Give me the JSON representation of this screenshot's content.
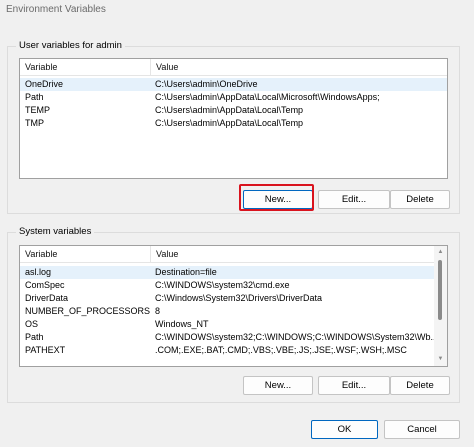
{
  "window": {
    "title": "Environment Variables"
  },
  "user_vars": {
    "group_label": "User variables for admin",
    "columns": [
      "Variable",
      "Value"
    ],
    "rows": [
      {
        "variable": "OneDrive",
        "value": "C:\\Users\\admin\\OneDrive"
      },
      {
        "variable": "Path",
        "value": "C:\\Users\\admin\\AppData\\Local\\Microsoft\\WindowsApps;"
      },
      {
        "variable": "TEMP",
        "value": "C:\\Users\\admin\\AppData\\Local\\Temp"
      },
      {
        "variable": "TMP",
        "value": "C:\\Users\\admin\\AppData\\Local\\Temp"
      }
    ],
    "buttons": {
      "new": "New...",
      "edit": "Edit...",
      "delete": "Delete"
    }
  },
  "system_vars": {
    "group_label": "System variables",
    "columns": [
      "Variable",
      "Value"
    ],
    "rows": [
      {
        "variable": "asl.log",
        "value": "Destination=file"
      },
      {
        "variable": "ComSpec",
        "value": "C:\\WINDOWS\\system32\\cmd.exe"
      },
      {
        "variable": "DriverData",
        "value": "C:\\Windows\\System32\\Drivers\\DriverData"
      },
      {
        "variable": "NUMBER_OF_PROCESSORS",
        "value": "8"
      },
      {
        "variable": "OS",
        "value": "Windows_NT"
      },
      {
        "variable": "Path",
        "value": "C:\\WINDOWS\\system32;C:\\WINDOWS;C:\\WINDOWS\\System32\\Wb..."
      },
      {
        "variable": "PATHEXT",
        "value": ".COM;.EXE;.BAT;.CMD;.VBS;.VBE;.JS;.JSE;.WSF;.WSH;.MSC"
      }
    ],
    "buttons": {
      "new": "New...",
      "edit": "Edit...",
      "delete": "Delete"
    }
  },
  "dialog_buttons": {
    "ok": "OK",
    "cancel": "Cancel"
  },
  "colors": {
    "highlight_border": "#d9131e",
    "selected_row": "#e5f1fb",
    "primary_border": "#0067c0"
  }
}
